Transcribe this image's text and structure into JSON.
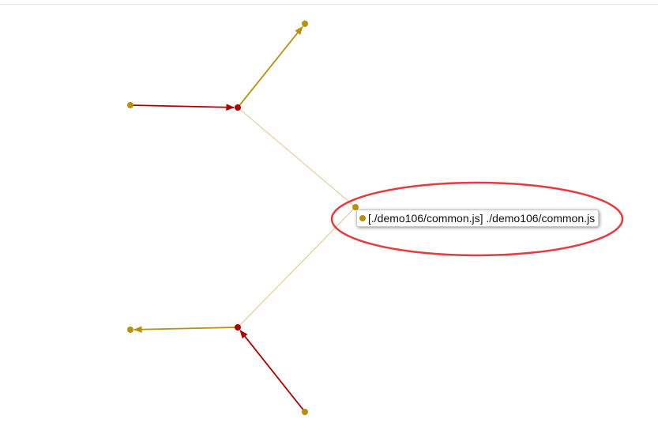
{
  "colors": {
    "node_gold": "#b8900b",
    "node_red": "#b00000",
    "link_gold": "#b8900b",
    "link_red": "#b00000",
    "link_faint": "#e3c48a",
    "highlight_ellipse": "#e8393d"
  },
  "graph": {
    "nodes": [
      {
        "id": "center",
        "kind": "gold"
      },
      {
        "id": "hub-top",
        "kind": "red"
      },
      {
        "id": "hub-bottom",
        "kind": "red"
      },
      {
        "id": "leaf-top-right",
        "kind": "gold"
      },
      {
        "id": "leaf-top-left",
        "kind": "gold"
      },
      {
        "id": "leaf-bottom-left",
        "kind": "gold"
      },
      {
        "id": "leaf-bottom-right",
        "kind": "gold"
      }
    ],
    "links": [
      {
        "from": "center",
        "to": "hub-top",
        "style": "faint"
      },
      {
        "from": "center",
        "to": "hub-bottom",
        "style": "faint"
      },
      {
        "from": "hub-top",
        "to": "leaf-top-right",
        "style": "gold",
        "arrow": "end"
      },
      {
        "from": "leaf-top-left",
        "to": "hub-top",
        "style": "red",
        "arrow": "end"
      },
      {
        "from": "hub-bottom",
        "to": "leaf-bottom-left",
        "style": "gold",
        "arrow": "end"
      },
      {
        "from": "leaf-bottom-right",
        "to": "hub-bottom",
        "style": "red",
        "arrow": "end"
      }
    ]
  },
  "tooltip": {
    "text": "[./demo106/common.js] ./demo106/common.js",
    "dot_color": "#b8900b"
  }
}
